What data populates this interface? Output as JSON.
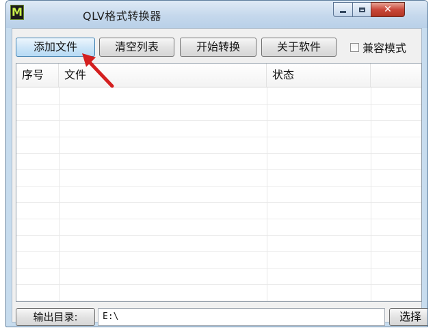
{
  "window": {
    "title": "QLV格式转换器",
    "icon_letter": "M",
    "controls": {
      "minimize": "minimize-icon",
      "maximize": "maximize-icon",
      "close": "close-icon"
    }
  },
  "toolbar": {
    "add_file": "添加文件",
    "clear_list": "清空列表",
    "start_convert": "开始转换",
    "about": "关于软件",
    "compat_mode": "兼容模式",
    "compat_mode_checked": false
  },
  "list": {
    "columns": [
      "序号",
      "文件",
      "状态",
      ""
    ],
    "rows": []
  },
  "footer": {
    "output_dir_label": "输出目录:",
    "output_path": "E:\\",
    "select_button": "选择"
  },
  "colors": {
    "annotation_arrow": "#d42020",
    "close_button": "#c9483a"
  }
}
